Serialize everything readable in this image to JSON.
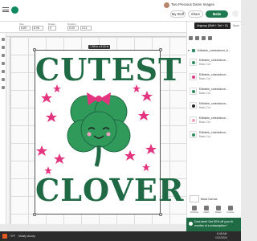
{
  "header": {
    "project_title": "Two Precious Damn Images",
    "buttons": {
      "my_stuff": "My Stuff",
      "share": "Share",
      "make": "Make"
    }
  },
  "toolbar": {
    "fields": [
      {
        "label": "Size",
        "value": "6.89"
      },
      {
        "label": "",
        "value": "8.95"
      },
      {
        "label": "Rotate",
        "value": "0"
      },
      {
        "label": "Position",
        "value": "0.03"
      },
      {
        "label": "",
        "value": "0.11"
      }
    ],
    "right_label": "Sync"
  },
  "canvas": {
    "dimensions_tag": "7.89 in x 9.00 in",
    "art_text_top": "CUTEST",
    "art_text_bottom": "CLOVER",
    "colors": {
      "green": "#1f6a45",
      "shamrock": "#2f9a5a",
      "pink": "#e3357f"
    }
  },
  "panel": {
    "tooltip": "Ungroup (Shift + Ctrl + G)",
    "group_name": "Editable_cutestclover_b...",
    "layers": [
      {
        "name": "Editable_cutestclove...",
        "sub": "Basic Cut"
      },
      {
        "name": "Editable_cutestclove...",
        "sub": "Basic Cut"
      },
      {
        "name": "Editable_cutestclove...",
        "sub": "Basic Cut"
      },
      {
        "name": "Editable_cutestclove...",
        "sub": "Basic Cut"
      },
      {
        "name": "Editable_cutestclove...",
        "sub": "Basic Cut"
      },
      {
        "name": "Editable_cutestclove...",
        "sub": "Basic Cut"
      }
    ],
    "blank_canvas_label": "Blank Canvas",
    "tools": [
      "Combine",
      "Attach",
      "Flatten",
      "Contour"
    ]
  },
  "deal": {
    "line1": "Deal alert! Get 50% off your fir",
    "line2": "months of a subscription.*"
  },
  "bottombar": {
    "temp": "73°F",
    "weather": "Mostly cloudy",
    "time": "8:48 AM",
    "date": "1/11/2024"
  }
}
